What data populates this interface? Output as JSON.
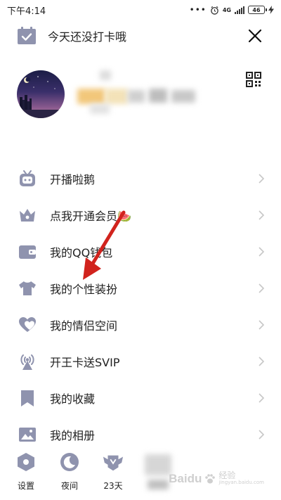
{
  "status_bar": {
    "time": "下午4:14",
    "network": "4G",
    "battery": "46"
  },
  "checkin": {
    "label": "今天还没打卡哦",
    "icon": "calendar-check-icon",
    "close_icon": "close-icon"
  },
  "profile": {
    "qr_icon": "qr-code-icon"
  },
  "menu": {
    "items": [
      {
        "label": "开播啦鹅",
        "icon": "tv-robot-icon"
      },
      {
        "label": "点我开通会员🍉",
        "icon": "crown-icon"
      },
      {
        "label": "我的QQ钱包",
        "icon": "wallet-icon"
      },
      {
        "label": "我的个性装扮",
        "icon": "tshirt-icon"
      },
      {
        "label": "我的情侣空间",
        "icon": "couple-hearts-icon"
      },
      {
        "label": "开王卡送SVIP",
        "icon": "antenna-icon"
      },
      {
        "label": "我的收藏",
        "icon": "bookmark-icon"
      },
      {
        "label": "我的相册",
        "icon": "photo-icon"
      }
    ]
  },
  "toolbar": {
    "settings_label": "设置",
    "night_label": "夜间",
    "days_label": "23天"
  },
  "watermark": {
    "brand": "Baidu",
    "sub": "经验",
    "url": "jingyan.baidu.com"
  },
  "colors": {
    "icon": "#8f93ae",
    "arrow": "#d1231d",
    "chevron": "#c7c7c7"
  }
}
